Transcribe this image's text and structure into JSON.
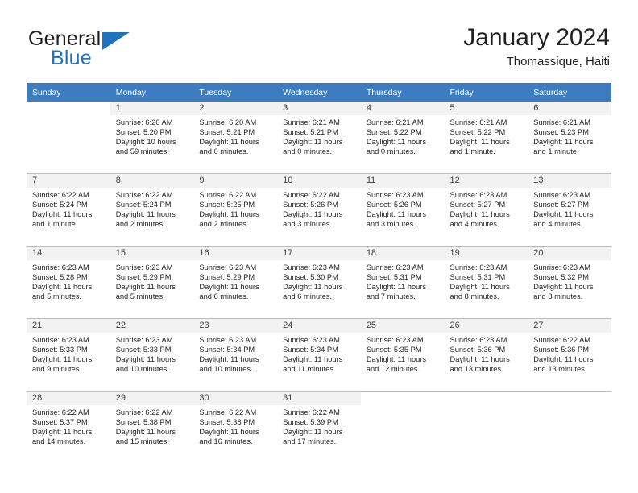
{
  "brand": {
    "name_part1": "General",
    "name_part2": "Blue",
    "accent_color": "#1f72bd",
    "logo_icon": "triangle-icon"
  },
  "header": {
    "title": "January 2024",
    "subtitle": "Thomassique, Haiti"
  },
  "table": {
    "header_bg": "#3c7cbf",
    "columns": [
      "Sunday",
      "Monday",
      "Tuesday",
      "Wednesday",
      "Thursday",
      "Friday",
      "Saturday"
    ]
  },
  "weeks": [
    [
      {
        "day": ""
      },
      {
        "day": "1",
        "sunrise": "Sunrise: 6:20 AM",
        "sunset": "Sunset: 5:20 PM",
        "daylight": "Daylight: 10 hours and 59 minutes."
      },
      {
        "day": "2",
        "sunrise": "Sunrise: 6:20 AM",
        "sunset": "Sunset: 5:21 PM",
        "daylight": "Daylight: 11 hours and 0 minutes."
      },
      {
        "day": "3",
        "sunrise": "Sunrise: 6:21 AM",
        "sunset": "Sunset: 5:21 PM",
        "daylight": "Daylight: 11 hours and 0 minutes."
      },
      {
        "day": "4",
        "sunrise": "Sunrise: 6:21 AM",
        "sunset": "Sunset: 5:22 PM",
        "daylight": "Daylight: 11 hours and 0 minutes."
      },
      {
        "day": "5",
        "sunrise": "Sunrise: 6:21 AM",
        "sunset": "Sunset: 5:22 PM",
        "daylight": "Daylight: 11 hours and 1 minute."
      },
      {
        "day": "6",
        "sunrise": "Sunrise: 6:21 AM",
        "sunset": "Sunset: 5:23 PM",
        "daylight": "Daylight: 11 hours and 1 minute."
      }
    ],
    [
      {
        "day": "7",
        "sunrise": "Sunrise: 6:22 AM",
        "sunset": "Sunset: 5:24 PM",
        "daylight": "Daylight: 11 hours and 1 minute."
      },
      {
        "day": "8",
        "sunrise": "Sunrise: 6:22 AM",
        "sunset": "Sunset: 5:24 PM",
        "daylight": "Daylight: 11 hours and 2 minutes."
      },
      {
        "day": "9",
        "sunrise": "Sunrise: 6:22 AM",
        "sunset": "Sunset: 5:25 PM",
        "daylight": "Daylight: 11 hours and 2 minutes."
      },
      {
        "day": "10",
        "sunrise": "Sunrise: 6:22 AM",
        "sunset": "Sunset: 5:26 PM",
        "daylight": "Daylight: 11 hours and 3 minutes."
      },
      {
        "day": "11",
        "sunrise": "Sunrise: 6:23 AM",
        "sunset": "Sunset: 5:26 PM",
        "daylight": "Daylight: 11 hours and 3 minutes."
      },
      {
        "day": "12",
        "sunrise": "Sunrise: 6:23 AM",
        "sunset": "Sunset: 5:27 PM",
        "daylight": "Daylight: 11 hours and 4 minutes."
      },
      {
        "day": "13",
        "sunrise": "Sunrise: 6:23 AM",
        "sunset": "Sunset: 5:27 PM",
        "daylight": "Daylight: 11 hours and 4 minutes."
      }
    ],
    [
      {
        "day": "14",
        "sunrise": "Sunrise: 6:23 AM",
        "sunset": "Sunset: 5:28 PM",
        "daylight": "Daylight: 11 hours and 5 minutes."
      },
      {
        "day": "15",
        "sunrise": "Sunrise: 6:23 AM",
        "sunset": "Sunset: 5:29 PM",
        "daylight": "Daylight: 11 hours and 5 minutes."
      },
      {
        "day": "16",
        "sunrise": "Sunrise: 6:23 AM",
        "sunset": "Sunset: 5:29 PM",
        "daylight": "Daylight: 11 hours and 6 minutes."
      },
      {
        "day": "17",
        "sunrise": "Sunrise: 6:23 AM",
        "sunset": "Sunset: 5:30 PM",
        "daylight": "Daylight: 11 hours and 6 minutes."
      },
      {
        "day": "18",
        "sunrise": "Sunrise: 6:23 AM",
        "sunset": "Sunset: 5:31 PM",
        "daylight": "Daylight: 11 hours and 7 minutes."
      },
      {
        "day": "19",
        "sunrise": "Sunrise: 6:23 AM",
        "sunset": "Sunset: 5:31 PM",
        "daylight": "Daylight: 11 hours and 8 minutes."
      },
      {
        "day": "20",
        "sunrise": "Sunrise: 6:23 AM",
        "sunset": "Sunset: 5:32 PM",
        "daylight": "Daylight: 11 hours and 8 minutes."
      }
    ],
    [
      {
        "day": "21",
        "sunrise": "Sunrise: 6:23 AM",
        "sunset": "Sunset: 5:33 PM",
        "daylight": "Daylight: 11 hours and 9 minutes."
      },
      {
        "day": "22",
        "sunrise": "Sunrise: 6:23 AM",
        "sunset": "Sunset: 5:33 PM",
        "daylight": "Daylight: 11 hours and 10 minutes."
      },
      {
        "day": "23",
        "sunrise": "Sunrise: 6:23 AM",
        "sunset": "Sunset: 5:34 PM",
        "daylight": "Daylight: 11 hours and 10 minutes."
      },
      {
        "day": "24",
        "sunrise": "Sunrise: 6:23 AM",
        "sunset": "Sunset: 5:34 PM",
        "daylight": "Daylight: 11 hours and 11 minutes."
      },
      {
        "day": "25",
        "sunrise": "Sunrise: 6:23 AM",
        "sunset": "Sunset: 5:35 PM",
        "daylight": "Daylight: 11 hours and 12 minutes."
      },
      {
        "day": "26",
        "sunrise": "Sunrise: 6:23 AM",
        "sunset": "Sunset: 5:36 PM",
        "daylight": "Daylight: 11 hours and 13 minutes."
      },
      {
        "day": "27",
        "sunrise": "Sunrise: 6:22 AM",
        "sunset": "Sunset: 5:36 PM",
        "daylight": "Daylight: 11 hours and 13 minutes."
      }
    ],
    [
      {
        "day": "28",
        "sunrise": "Sunrise: 6:22 AM",
        "sunset": "Sunset: 5:37 PM",
        "daylight": "Daylight: 11 hours and 14 minutes."
      },
      {
        "day": "29",
        "sunrise": "Sunrise: 6:22 AM",
        "sunset": "Sunset: 5:38 PM",
        "daylight": "Daylight: 11 hours and 15 minutes."
      },
      {
        "day": "30",
        "sunrise": "Sunrise: 6:22 AM",
        "sunset": "Sunset: 5:38 PM",
        "daylight": "Daylight: 11 hours and 16 minutes."
      },
      {
        "day": "31",
        "sunrise": "Sunrise: 6:22 AM",
        "sunset": "Sunset: 5:39 PM",
        "daylight": "Daylight: 11 hours and 17 minutes."
      },
      {
        "day": ""
      },
      {
        "day": ""
      },
      {
        "day": ""
      }
    ]
  ]
}
